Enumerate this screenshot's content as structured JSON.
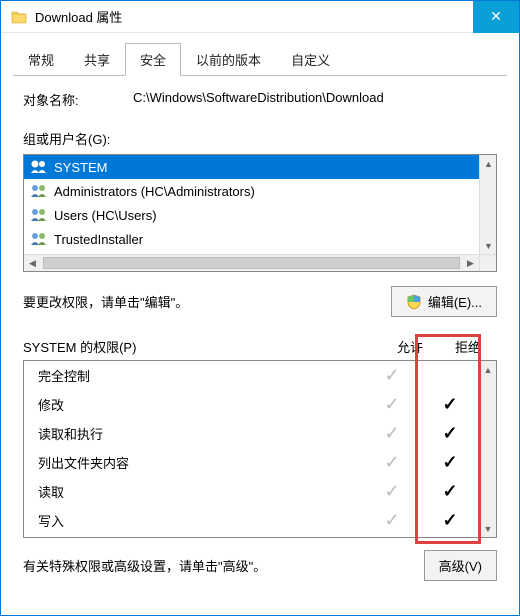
{
  "window": {
    "title": "Download 属性",
    "close_glyph": "✕"
  },
  "tabs": {
    "t0": "常规",
    "t1": "共享",
    "t2": "安全",
    "t3": "以前的版本",
    "t4": "自定义"
  },
  "object": {
    "label": "对象名称:",
    "value": "C:\\Windows\\SoftwareDistribution\\Download"
  },
  "groups": {
    "label": "组或用户名(G):",
    "items": {
      "i0": "SYSTEM",
      "i1": "Administrators (HC\\Administrators)",
      "i2": "Users (HC\\Users)",
      "i3": "TrustedInstaller"
    }
  },
  "edit": {
    "hint": "要更改权限，请单击\"编辑\"。",
    "button": "编辑(E)..."
  },
  "perms": {
    "header_for": "SYSTEM 的权限(P)",
    "allow": "允许",
    "deny": "拒绝",
    "rows": {
      "r0": "完全控制",
      "r1": "修改",
      "r2": "读取和执行",
      "r3": "列出文件夹内容",
      "r4": "读取",
      "r5": "写入"
    }
  },
  "advanced": {
    "hint": "有关特殊权限或高级设置，请单击\"高级\"。",
    "button": "高级(V)"
  }
}
